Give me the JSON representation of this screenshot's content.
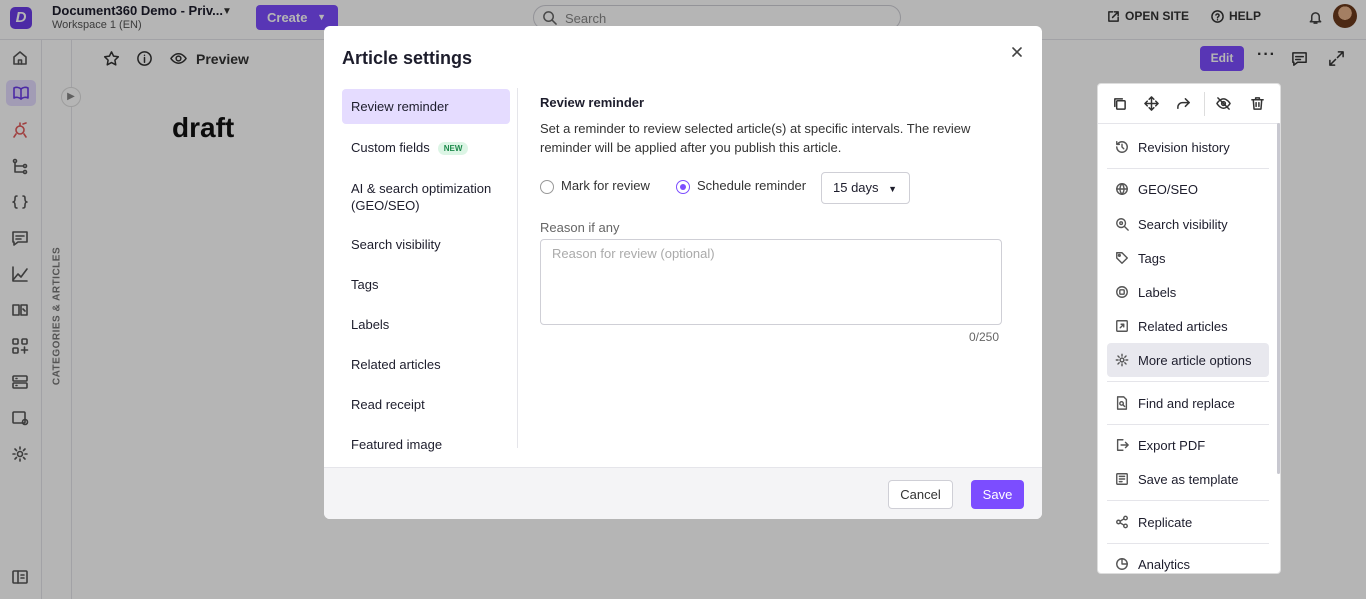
{
  "app": {
    "project_name": "Document360 Demo - Priv...",
    "workspace": "Workspace 1 (EN)",
    "create_label": "Create",
    "search_placeholder": "Search",
    "open_site_label": "OPEN SITE",
    "help_label": "HELP"
  },
  "sidebar": {
    "category_label": "CATEGORIES & ARTICLES"
  },
  "article": {
    "view_label": "Preview",
    "title": "draft",
    "edit_label": "Edit",
    "more_label": "···"
  },
  "side_menu": {
    "items": [
      {
        "label": "Revision history",
        "icon": "history-icon"
      },
      {
        "label": "GEO/SEO",
        "icon": "globe-icon"
      },
      {
        "label": "Search visibility",
        "icon": "search-visibility-icon"
      },
      {
        "label": "Tags",
        "icon": "tag-icon"
      },
      {
        "label": "Labels",
        "icon": "label-icon"
      },
      {
        "label": "Related articles",
        "icon": "related-articles-icon"
      },
      {
        "label": "More article options",
        "icon": "gear-icon"
      },
      {
        "label": "Find and replace",
        "icon": "find-replace-icon"
      },
      {
        "label": "Export PDF",
        "icon": "export-icon"
      },
      {
        "label": "Save as template",
        "icon": "template-icon"
      },
      {
        "label": "Replicate",
        "icon": "replicate-icon"
      },
      {
        "label": "Analytics",
        "icon": "analytics-icon"
      }
    ]
  },
  "modal": {
    "title": "Article settings",
    "nav": [
      {
        "label": "Review reminder"
      },
      {
        "label": "Custom fields",
        "badge": "NEW"
      },
      {
        "label": "AI & search optimization (GEO/SEO)"
      },
      {
        "label": "Search visibility"
      },
      {
        "label": "Tags"
      },
      {
        "label": "Labels"
      },
      {
        "label": "Related articles"
      },
      {
        "label": "Read receipt"
      },
      {
        "label": "Featured image"
      }
    ],
    "content": {
      "heading": "Review reminder",
      "description": "Set a reminder to review selected article(s) at specific intervals. The review reminder will be applied after you publish this article.",
      "option_mark": "Mark for review",
      "option_schedule": "Schedule reminder",
      "selected_option": "Schedule reminder",
      "interval_value": "15 days",
      "reason_label": "Reason if any",
      "reason_placeholder": "Reason for review (optional)",
      "reason_value": "",
      "char_count": "0/250"
    },
    "cancel_label": "Cancel",
    "save_label": "Save"
  },
  "colors": {
    "accent": "#7c4dff",
    "accent_light": "#e5dcff",
    "overlay": "rgba(0,0,0,0.29)"
  }
}
